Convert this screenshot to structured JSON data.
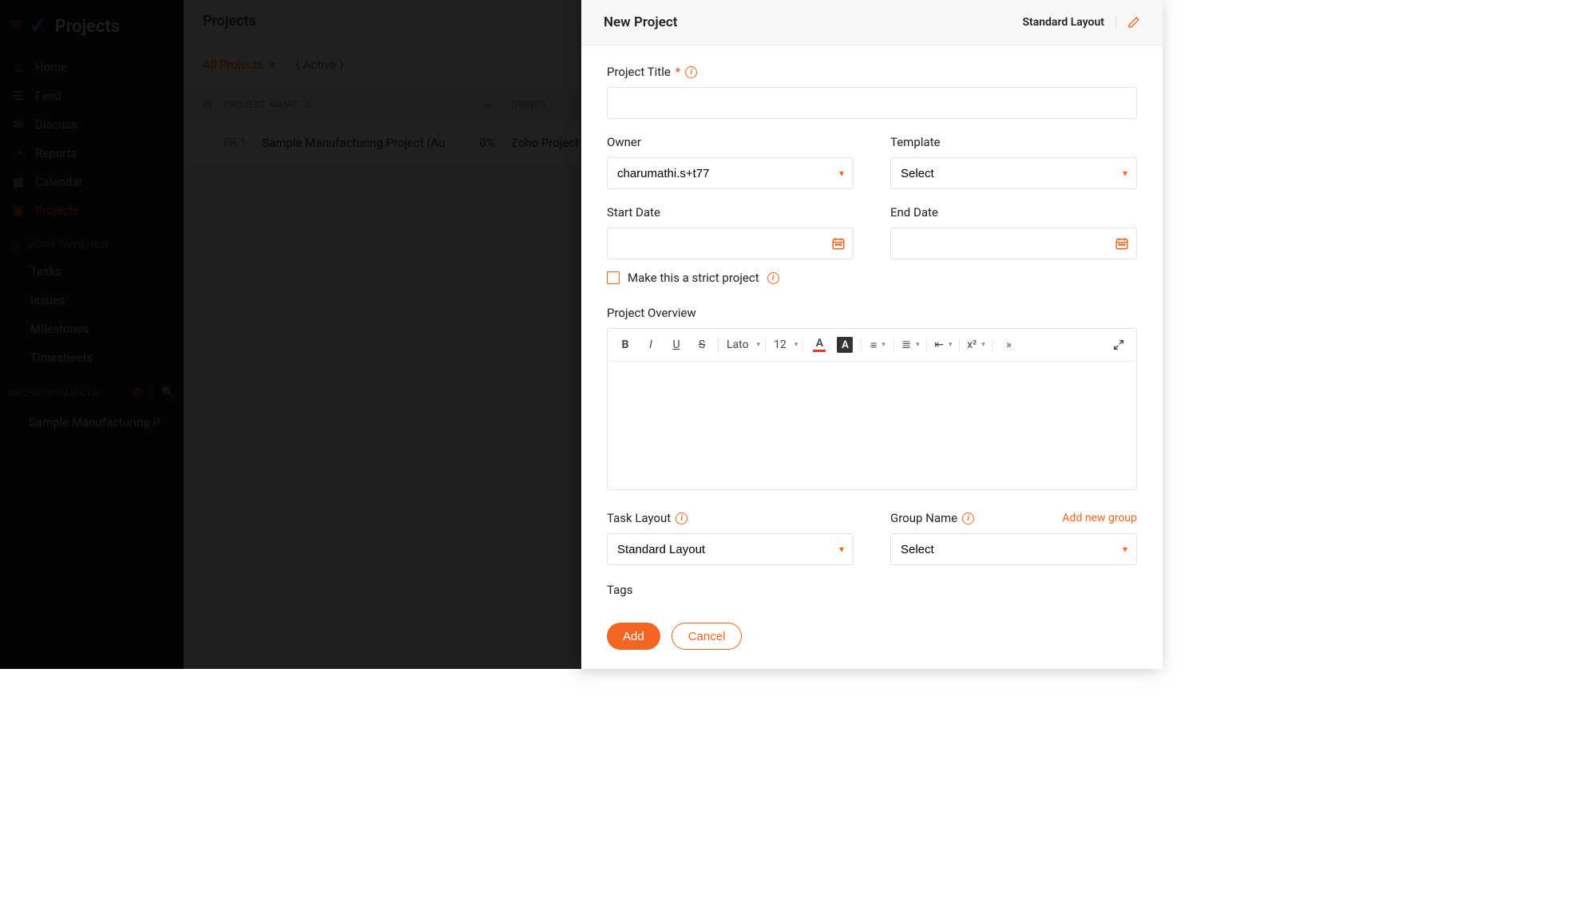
{
  "brand": "Projects",
  "sidebar": {
    "items": [
      {
        "label": "Home",
        "icon": "home"
      },
      {
        "label": "Feed",
        "icon": "feed"
      },
      {
        "label": "Discuss",
        "icon": "discuss"
      },
      {
        "label": "Reports",
        "icon": "reports"
      },
      {
        "label": "Calendar",
        "icon": "calendar"
      },
      {
        "label": "Projects",
        "icon": "projects"
      }
    ],
    "work_overview_label": "WORK OVERVIEW",
    "work_items": [
      "Tasks",
      "Issues",
      "Milestones",
      "Timesheets"
    ],
    "recent_label": "RECENT PROJECTS",
    "recent_project": "Sample Manufacturing P"
  },
  "page": {
    "title": "Projects",
    "filter_label": "All Projects",
    "status_label": "( Active )"
  },
  "table": {
    "headers": {
      "name": "PROJECT NAME",
      "pct": "%",
      "owner": "OWNER"
    },
    "rows": [
      {
        "pid": "FR-1",
        "name": "Sample Manufacturing Project (Au",
        "pct": "0%",
        "owner": "Zoho Project"
      }
    ]
  },
  "drawer": {
    "title": "New Project",
    "layout_name": "Standard Layout",
    "project_title_label": "Project Title",
    "owner_label": "Owner",
    "owner_value": "charumathi.s+t77",
    "template_label": "Template",
    "template_value": "Select",
    "start_date_label": "Start Date",
    "end_date_label": "End Date",
    "strict_label": "Make this a strict project",
    "overview_label": "Project Overview",
    "task_layout_label": "Task Layout",
    "task_layout_value": "Standard Layout",
    "group_label": "Group Name",
    "add_group_label": "Add new group",
    "group_value": "Select",
    "tags_label": "Tags",
    "rte": {
      "font": "Lato",
      "size": "12"
    },
    "add_button": "Add",
    "cancel_button": "Cancel"
  }
}
